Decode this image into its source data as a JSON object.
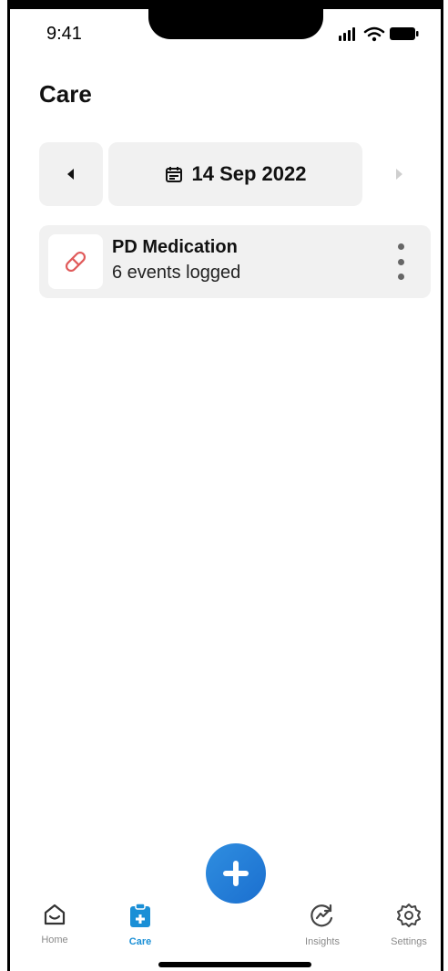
{
  "status_bar": {
    "time": "9:41"
  },
  "page": {
    "title": "Care"
  },
  "date_nav": {
    "date": "14 Sep 2022"
  },
  "log_card": {
    "title": "PD Medication",
    "subtitle": "6 events logged",
    "icon": "pill-icon"
  },
  "tab_bar": {
    "items": [
      {
        "label": "Home",
        "icon": "home-icon",
        "active": false
      },
      {
        "label": "Care",
        "icon": "care-clipboard-icon",
        "active": true
      },
      {
        "label": "Insights",
        "icon": "insights-icon",
        "active": false
      },
      {
        "label": "Settings",
        "icon": "settings-gear-icon",
        "active": false
      }
    ],
    "fab_icon": "plus-icon"
  },
  "colors": {
    "accent": "#1a8fd6",
    "fab": "#2f8ee0",
    "card_bg": "#f1f1f1",
    "pill": "#e05a5a"
  }
}
